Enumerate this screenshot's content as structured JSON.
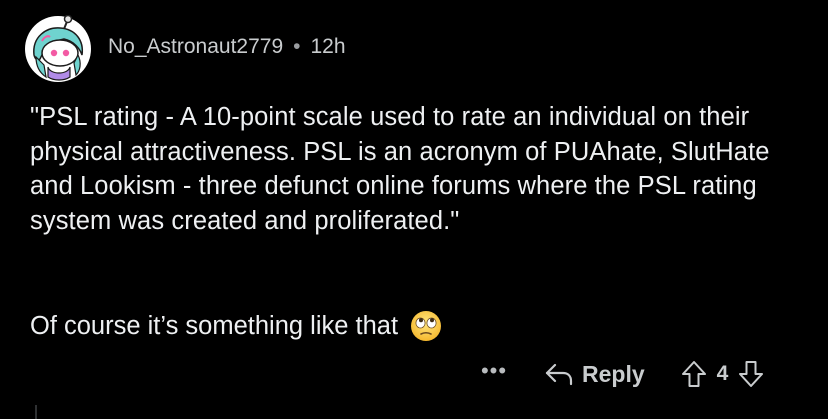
{
  "comment": {
    "author": "No_Astronaut2779",
    "separator": "•",
    "time": "12h",
    "body_paragraph_1": "\"PSL rating - A 10-point scale used to rate an individual on their physical attractiveness. PSL is an acronym of PUAhate, SlutHate and Lookism - three defunct online forums where the PSL rating system was created and proliferated.\"",
    "body_paragraph_2": "Of course it’s something like that",
    "emoji": "face-with-rolling-eyes"
  },
  "actions": {
    "more_label": "•••",
    "reply_label": "Reply",
    "vote_count": "4"
  },
  "colors": {
    "background": "#000000",
    "text": "#eef0f2",
    "meta": "#c9ccce"
  }
}
